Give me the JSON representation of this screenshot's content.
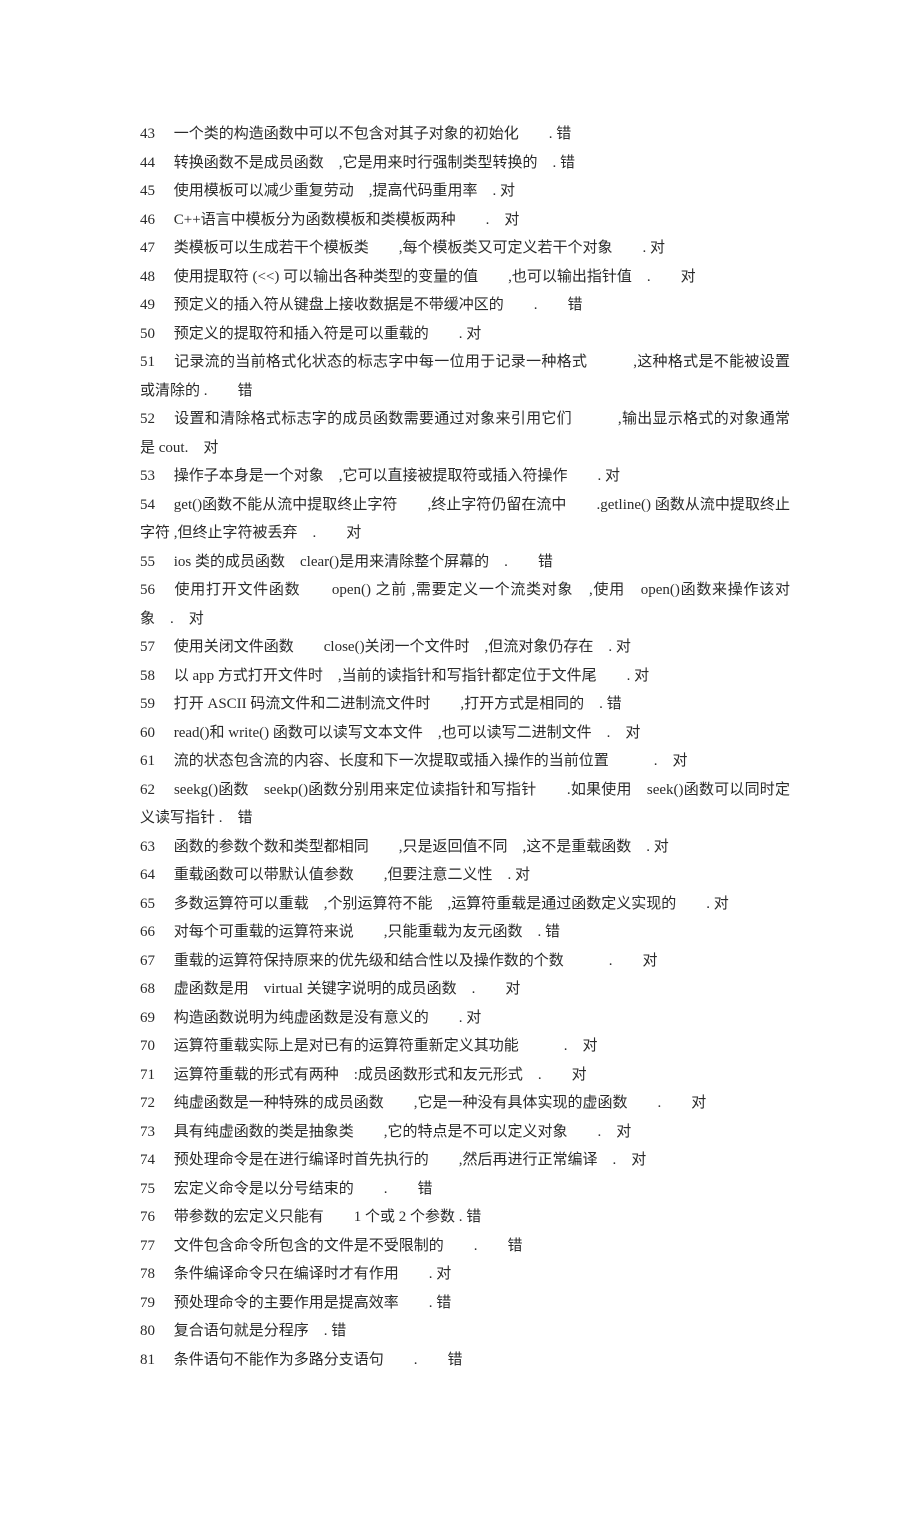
{
  "items": [
    {
      "n": "43",
      "text": "一个类的构造函数中可以不包含对其子对象的初始化　　. 错"
    },
    {
      "n": "44",
      "text": "转换函数不是成员函数　,它是用来时行强制类型转换的　. 错"
    },
    {
      "n": "45",
      "text": "使用模板可以减少重复劳动　,提高代码重用率　. 对"
    },
    {
      "n": "46",
      "text": "C++语言中模板分为函数模板和类模板两种　　.　对"
    },
    {
      "n": "47",
      "text": "类模板可以生成若干个模板类　　,每个模板类又可定义若干个对象　　. 对"
    },
    {
      "n": "48",
      "text": "使用提取符 (<<) 可以输出各种类型的变量的值　　,也可以输出指针值　.　　对"
    },
    {
      "n": "49",
      "text": "预定义的插入符从键盘上接收数据是不带缓冲区的　　.　　错"
    },
    {
      "n": "50",
      "text": "预定义的提取符和插入符是可以重载的　　. 对"
    },
    {
      "n": "51",
      "text": "记录流的当前格式化状态的标志字中每一位用于记录一种格式　　　,这种格式是不能被设置或清除的 .　　错"
    },
    {
      "n": "52",
      "text": "设置和清除格式标志字的成员函数需要通过对象来引用它们　　　,输出显示格式的对象通常是 cout.　对"
    },
    {
      "n": "53",
      "text": "操作子本身是一个对象　,它可以直接被提取符或插入符操作　　. 对"
    },
    {
      "n": "54",
      "text": "get()函数不能从流中提取终止字符　　,终止字符仍留在流中　　.getline() 函数从流中提取终止字符 ,但终止字符被丢弃　.　　对"
    },
    {
      "n": "55",
      "text": "ios 类的成员函数　clear()是用来清除整个屏幕的　.　　错"
    },
    {
      "n": "56",
      "text": "使用打开文件函数　　open() 之前 ,需要定义一个流类对象　,使用　open()函数来操作该对象　.　对"
    },
    {
      "n": "57",
      "text": "使用关闭文件函数　　close()关闭一个文件时　,但流对象仍存在　. 对"
    },
    {
      "n": "58",
      "text": "以 app 方式打开文件时　,当前的读指针和写指针都定位于文件尾　　. 对"
    },
    {
      "n": "59",
      "text": "打开 ASCII 码流文件和二进制流文件时　　,打开方式是相同的　. 错"
    },
    {
      "n": "60",
      "text": "read()和 write() 函数可以读写文本文件　,也可以读写二进制文件　.　对"
    },
    {
      "n": "61",
      "text": "流的状态包含流的内容、长度和下一次提取或插入操作的当前位置　　　.　对"
    },
    {
      "n": "62",
      "text": "seekg()函数　seekp()函数分别用来定位读指针和写指针　　.如果使用　seek()函数可以同时定义读写指针 .　错"
    },
    {
      "n": "63",
      "text": "函数的参数个数和类型都相同　　,只是返回值不同　,这不是重载函数　. 对"
    },
    {
      "n": "64",
      "text": "重载函数可以带默认值参数　　,但要注意二义性　. 对"
    },
    {
      "n": "65",
      "text": "多数运算符可以重载　,个别运算符不能　,运算符重载是通过函数定义实现的　　. 对"
    },
    {
      "n": "66",
      "text": "对每个可重载的运算符来说　　,只能重载为友元函数　. 错"
    },
    {
      "n": "67",
      "text": "重载的运算符保持原来的优先级和结合性以及操作数的个数　　　.　　对"
    },
    {
      "n": "68",
      "text": "虚函数是用　virtual 关键字说明的成员函数　.　　对"
    },
    {
      "n": "69",
      "text": "构造函数说明为纯虚函数是没有意义的　　. 对"
    },
    {
      "n": "70",
      "text": "运算符重载实际上是对已有的运算符重新定义其功能　　　.　对"
    },
    {
      "n": "71",
      "text": "运算符重载的形式有两种　:成员函数形式和友元形式　.　　对"
    },
    {
      "n": "72",
      "text": "纯虚函数是一种特殊的成员函数　　,它是一种没有具体实现的虚函数　　.　　对"
    },
    {
      "n": "73",
      "text": "具有纯虚函数的类是抽象类　　,它的特点是不可以定义对象　　.　对"
    },
    {
      "n": "74",
      "text": "预处理命令是在进行编译时首先执行的　　,然后再进行正常编译　.　对"
    },
    {
      "n": "75",
      "text": "宏定义命令是以分号结束的　　.　　错"
    },
    {
      "n": "76",
      "text": "带参数的宏定义只能有　　1 个或 2 个参数 . 错"
    },
    {
      "n": "77",
      "text": "文件包含命令所包含的文件是不受限制的　　.　　错"
    },
    {
      "n": "78",
      "text": "条件编译命令只在编译时才有作用　　. 对"
    },
    {
      "n": "79",
      "text": "预处理命令的主要作用是提高效率　　. 错"
    },
    {
      "n": "80",
      "text": "复合语句就是分程序　. 错"
    },
    {
      "n": "81",
      "text": "条件语句不能作为多路分支语句　　.　　错"
    }
  ]
}
